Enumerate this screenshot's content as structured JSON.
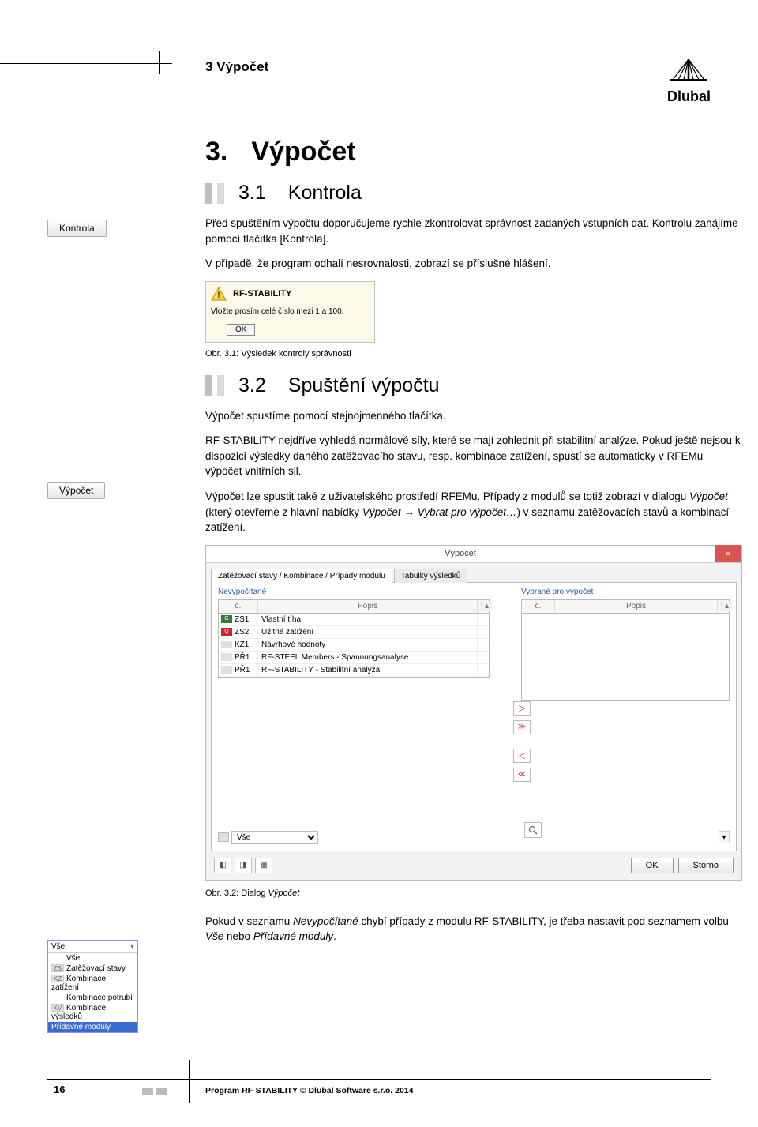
{
  "header": {
    "title": "3 Výpočet",
    "logo": "Dlubal"
  },
  "margin": {
    "btn_kontrola": "Kontrola",
    "btn_vypocet": "Výpočet"
  },
  "s3": {
    "num": "3.",
    "title": "Výpočet"
  },
  "s31": {
    "num": "3.1",
    "title": "Kontrola",
    "p1": "Před spuštěním výpočtu doporučujeme rychle zkontrolovat správnost zadaných vstupních dat. Kontrolu zahájíme pomocí tlačítka [Kontrola].",
    "p2": "V případě, že program odhalí nesrovnalosti, zobrazí se příslušné hlášení."
  },
  "warn": {
    "title": "RF-STABILITY",
    "msg": "Vložte prosím celé číslo mezi 1 a 100.",
    "ok": "OK"
  },
  "cap31": {
    "pre": "Obr. 3.1: ",
    "text": "Výsledek kontroly správnosti"
  },
  "s32": {
    "num": "3.2",
    "title": "Spuštění výpočtu",
    "p1": "Výpočet spustíme pomocí stejnojmenného tlačítka.",
    "p2": "RF-STABILITY nejdříve vyhledá normálové síly, které se mají zohlednit při stabilitní analýze. Pokud ještě nejsou k dispozici výsledky daného zatěžovacího stavu, resp. kombinace zatížení, spustí se automaticky v RFEMu výpočet vnitřních sil.",
    "p3a": "Výpočet lze spustit také z uživatelského prostředí RFEMu. Případy z modulů se totiž zobrazí v dialogu ",
    "p3b": "Výpočet",
    "p3c": " (který otevřeme z hlavní nabídky ",
    "p3d": "Výpočet",
    "p3e": " → ",
    "p3f": "Vybrat pro výpočet…",
    "p3g": ") v seznamu zatěžovacích stavů a kombinací zatížení."
  },
  "dlg": {
    "title": "Výpočet",
    "tab1": "Zatěžovací stavy / Kombinace / Případy modulu",
    "tab2": "Tabulky výsledků",
    "left_title": "Nevypočítané",
    "right_title": "Vybrané pro výpočet",
    "col_c": "č.",
    "col_p": "Popis",
    "rows": [
      {
        "tag": "G",
        "cls": "g",
        "code": "ZS1",
        "desc": "Vlastní tíha"
      },
      {
        "tag": "Q",
        "cls": "r",
        "code": "ZS2",
        "desc": "Užitné zatížení"
      },
      {
        "tag": "",
        "cls": "gr",
        "code": "KZ1",
        "desc": "Návrhové hodnoty"
      },
      {
        "tag": "",
        "cls": "gr",
        "code": "PŘ1",
        "desc": "RF-STEEL Members - Spannungsanalyse"
      },
      {
        "tag": "",
        "cls": "gr",
        "code": "PŘ1",
        "desc": "RF-STABILITY - Stabilitní analýza"
      }
    ],
    "filter_label": "Vše",
    "ok": "OK",
    "cancel": "Storno",
    "move": {
      "r": "＞",
      "rr": "≫",
      "l": "＜",
      "ll": "≪"
    }
  },
  "cap32": {
    "pre": "Obr. 3.2: ",
    "text": "Dialog ",
    "it": "Výpočet"
  },
  "p_after": {
    "a": "Pokud v seznamu ",
    "b": "Nevypočítané",
    "c": " chybí případy z modulu RF-STABILITY, je třeba nastavit pod seznamem volbu ",
    "d": "Vše",
    "e": " nebo ",
    "f": "Přídavné moduly",
    "g": "."
  },
  "filterlist": {
    "top": "Vše",
    "items": [
      {
        "tag": "",
        "label": "Vše"
      },
      {
        "tag": "ZS",
        "label": "Zatěžovací stavy"
      },
      {
        "tag": "KZ",
        "label": "Kombinace zatížení"
      },
      {
        "tag": "",
        "label": "Kombinace potrubí"
      },
      {
        "tag": "KV",
        "label": "Kombinace výsledků"
      }
    ],
    "selected": "Přídavné moduly"
  },
  "footer": {
    "page": "16",
    "text": "Program RF-STABILITY © Dlubal Software s.r.o. 2014"
  }
}
